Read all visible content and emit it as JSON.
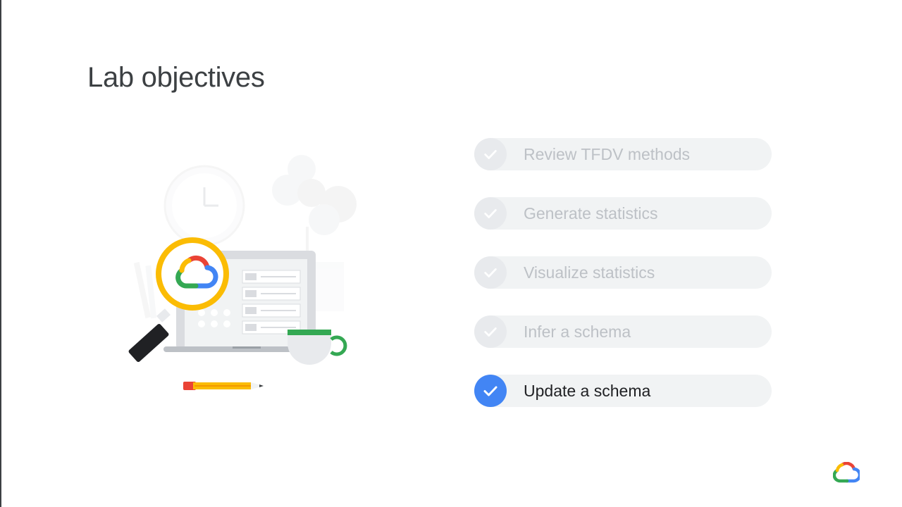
{
  "slide": {
    "title": "Lab objectives"
  },
  "objectives": [
    {
      "label": "Review TFDV methods",
      "status": "done",
      "highlighted": false
    },
    {
      "label": "Generate statistics",
      "status": "done",
      "highlighted": false
    },
    {
      "label": "Visualize statistics",
      "status": "done",
      "highlighted": false
    },
    {
      "label": "Infer a schema",
      "status": "done",
      "highlighted": false
    },
    {
      "label": "Update a schema",
      "status": "current",
      "highlighted": true
    }
  ],
  "icons": {
    "check": "check-icon",
    "logo": "google-cloud-logo-icon",
    "illustration": "magnifier-laptop-illustration"
  },
  "colors": {
    "accent_blue": "#4285f4",
    "google_red": "#ea4335",
    "google_yellow": "#fbbc04",
    "google_green": "#34a853",
    "pill_background": "#f1f3f4",
    "inactive_text": "#bdc1c6",
    "active_text": "#202124",
    "title_text": "#3c4043"
  }
}
